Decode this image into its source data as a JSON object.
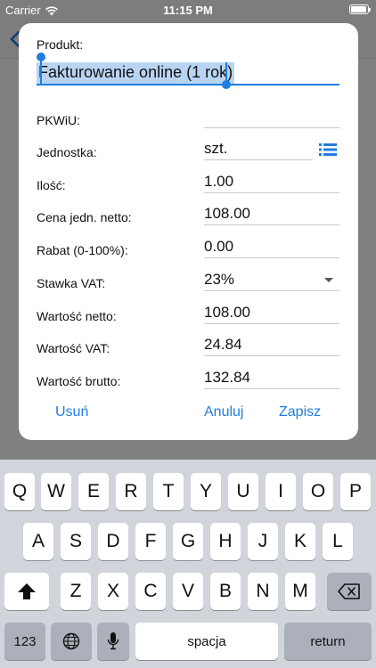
{
  "status_bar": {
    "carrier": "Carrier",
    "time": "11:15 PM"
  },
  "dialog": {
    "product_label": "Produkt:",
    "product_value": "Fakturowanie online (1 rok)",
    "fields": [
      {
        "label": "PKWiU:",
        "value": ""
      },
      {
        "label": "Jednostka:",
        "value": "szt."
      },
      {
        "label": "Ilość:",
        "value": "1.00"
      },
      {
        "label": "Cena jedn. netto:",
        "value": "108.00"
      },
      {
        "label": "Rabat (0-100%):",
        "value": "0.00"
      },
      {
        "label": "Stawka VAT:",
        "value": "23%"
      },
      {
        "label": "Wartość netto:",
        "value": "108.00"
      },
      {
        "label": "Wartość VAT:",
        "value": "24.84"
      },
      {
        "label": "Wartość brutto:",
        "value": "132.84"
      }
    ],
    "buttons": {
      "delete": "Usuń",
      "cancel": "Anuluj",
      "save": "Zapisz"
    }
  },
  "keyboard": {
    "row1": [
      "Q",
      "W",
      "E",
      "R",
      "T",
      "Y",
      "U",
      "I",
      "O",
      "P"
    ],
    "row2": [
      "A",
      "S",
      "D",
      "F",
      "G",
      "H",
      "J",
      "K",
      "L"
    ],
    "row3": [
      "Z",
      "X",
      "C",
      "V",
      "B",
      "N",
      "M"
    ],
    "numbers_key": "123",
    "space_key": "spacja",
    "return_key": "return"
  },
  "colors": {
    "accent": "#1f7ee0",
    "selection": "#b9d4f3",
    "overlay": "#808080",
    "keyboard_bg": "#d1d4da"
  },
  "icons": {
    "wifi": "wifi-icon",
    "battery": "battery-icon",
    "back": "chevron-left-icon",
    "unit_list": "list-icon",
    "dropdown": "caret-down-icon",
    "shift": "shift-arrow-icon",
    "backspace": "backspace-icon",
    "globe": "globe-icon",
    "microphone": "microphone-icon"
  }
}
